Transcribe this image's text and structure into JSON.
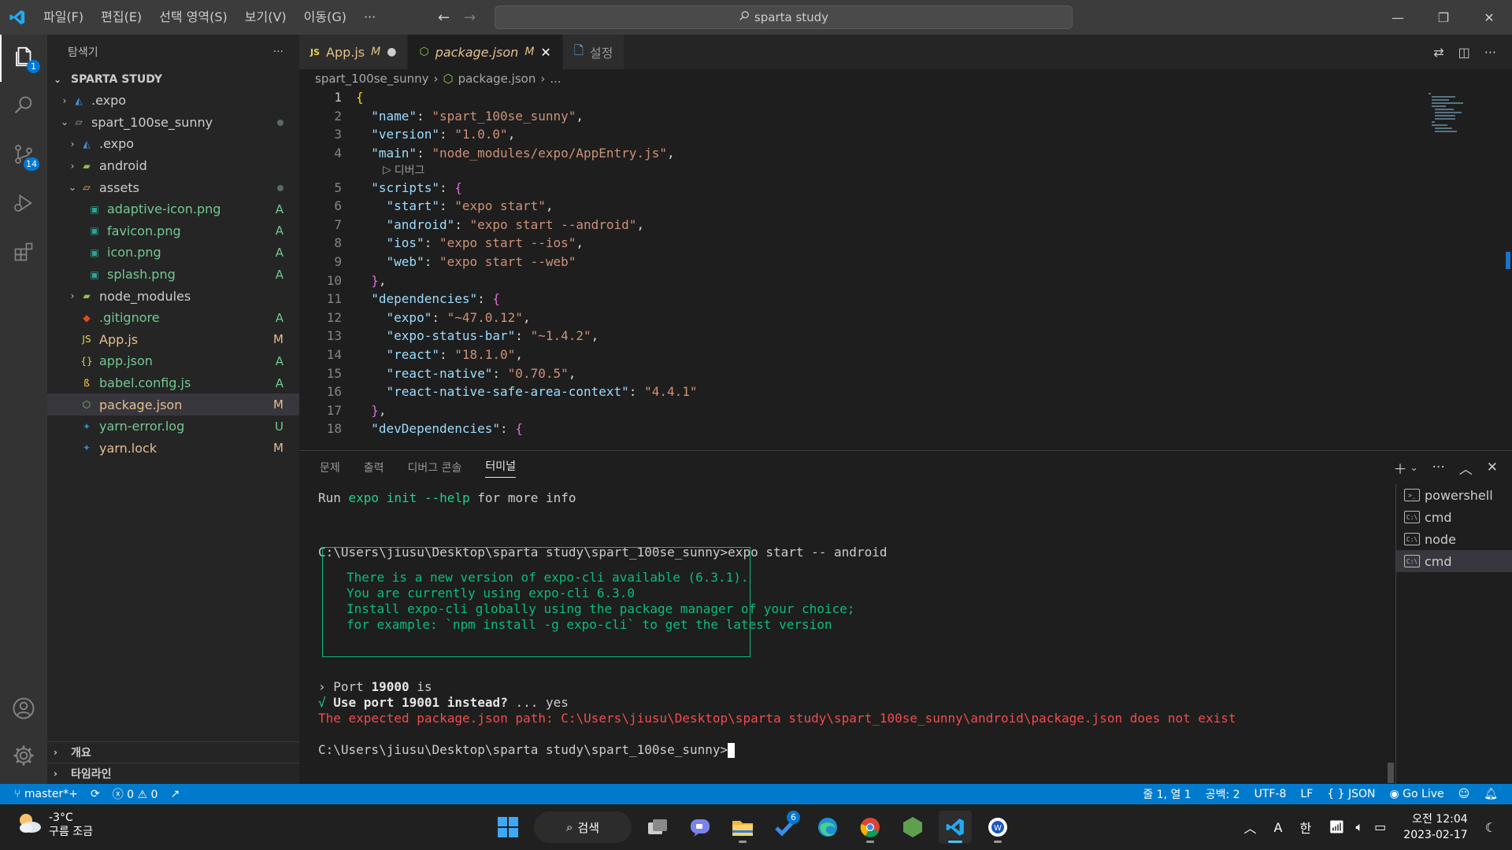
{
  "titlebar": {
    "menu": [
      "파일(F)",
      "편집(E)",
      "선택 영역(S)",
      "보기(V)",
      "이동(G)",
      "···"
    ],
    "search_text": "sparta study"
  },
  "activity": {
    "explorer_badge": "1",
    "scm_badge": "14"
  },
  "sidebar": {
    "header": "탐색기",
    "more": "···",
    "section": "SPARTA STUDY",
    "tree": [
      {
        "name": ".expo",
        "depth": 0,
        "chev": "›",
        "icon": "expo",
        "status": ""
      },
      {
        "name": "spart_100se_sunny",
        "depth": 0,
        "chev": "⌄",
        "icon": "folder-open",
        "status": "dot"
      },
      {
        "name": ".expo",
        "depth": 1,
        "chev": "›",
        "icon": "expo",
        "status": ""
      },
      {
        "name": "android",
        "depth": 1,
        "chev": "›",
        "icon": "folder-android",
        "status": ""
      },
      {
        "name": "assets",
        "depth": 1,
        "chev": "⌄",
        "icon": "folder-open-yellow",
        "status": "dot"
      },
      {
        "name": "adaptive-icon.png",
        "depth": 2,
        "chev": "",
        "icon": "image",
        "status": "A"
      },
      {
        "name": "favicon.png",
        "depth": 2,
        "chev": "",
        "icon": "image",
        "status": "A"
      },
      {
        "name": "icon.png",
        "depth": 2,
        "chev": "",
        "icon": "image",
        "status": "A"
      },
      {
        "name": "splash.png",
        "depth": 2,
        "chev": "",
        "icon": "image",
        "status": "A"
      },
      {
        "name": "node_modules",
        "depth": 1,
        "chev": "›",
        "icon": "folder-node",
        "status": ""
      },
      {
        "name": ".gitignore",
        "depth": 1,
        "chev": "",
        "icon": "git",
        "status": "A"
      },
      {
        "name": "App.js",
        "depth": 1,
        "chev": "",
        "icon": "js",
        "status": "M"
      },
      {
        "name": "app.json",
        "depth": 1,
        "chev": "",
        "icon": "json",
        "status": "A"
      },
      {
        "name": "babel.config.js",
        "depth": 1,
        "chev": "",
        "icon": "babel",
        "status": "A"
      },
      {
        "name": "package.json",
        "depth": 1,
        "chev": "",
        "icon": "node",
        "status": "M"
      },
      {
        "name": "yarn-error.log",
        "depth": 1,
        "chev": "",
        "icon": "yarn",
        "status": "U"
      },
      {
        "name": "yarn.lock",
        "depth": 1,
        "chev": "",
        "icon": "yarn",
        "status": "M"
      }
    ],
    "outline": "개요",
    "timeline": "타임라인"
  },
  "tabs": [
    {
      "label": "App.js",
      "mod": "M",
      "icon": "js",
      "active": false
    },
    {
      "label": "package.json",
      "mod": "M",
      "icon": "node",
      "active": true
    },
    {
      "label": "설정",
      "mod": "",
      "icon": "settings-file",
      "active": false
    }
  ],
  "breadcrumb": [
    "spart_100se_sunny",
    "package.json",
    "..."
  ],
  "code_lens": "디버그",
  "code": [
    {
      "n": "1",
      "t": "{"
    },
    {
      "n": "2",
      "t": "  \"name\": \"spart_100se_sunny\","
    },
    {
      "n": "3",
      "t": "  \"version\": \"1.0.0\","
    },
    {
      "n": "4",
      "t": "  \"main\": \"node_modules/expo/AppEntry.js\","
    },
    {
      "n": "5",
      "t": "  \"scripts\": {"
    },
    {
      "n": "6",
      "t": "    \"start\": \"expo start\","
    },
    {
      "n": "7",
      "t": "    \"android\": \"expo start --android\","
    },
    {
      "n": "8",
      "t": "    \"ios\": \"expo start --ios\","
    },
    {
      "n": "9",
      "t": "    \"web\": \"expo start --web\""
    },
    {
      "n": "10",
      "t": "  },"
    },
    {
      "n": "11",
      "t": "  \"dependencies\": {"
    },
    {
      "n": "12",
      "t": "    \"expo\": \"~47.0.12\","
    },
    {
      "n": "13",
      "t": "    \"expo-status-bar\": \"~1.4.2\","
    },
    {
      "n": "14",
      "t": "    \"react\": \"18.1.0\","
    },
    {
      "n": "15",
      "t": "    \"react-native\": \"0.70.5\","
    },
    {
      "n": "16",
      "t": "    \"react-native-safe-area-context\": \"4.4.1\""
    },
    {
      "n": "17",
      "t": "  },"
    },
    {
      "n": "18",
      "t": "  \"devDependencies\": {"
    }
  ],
  "panel": {
    "tabs": [
      "문제",
      "출력",
      "디버그 콘솔",
      "터미널"
    ],
    "terminal": {
      "line1_pre": "Run ",
      "line1_cmd": "expo init --help",
      "line1_post": " for more info",
      "prompt1": "C:\\Users\\jiusu\\Desktop\\sparta study\\spart_100se_sunny>expo start -- android",
      "box": [
        "There is a new version of expo-cli available (6.3.1).",
        "You are currently using expo-cli 6.3.0",
        "Install expo-cli globally using the package manager of your choice;",
        "for example: `npm install -g expo-cli` to get the latest version"
      ],
      "port_pre": "› Port ",
      "port_num": "19000",
      "port_post": " is",
      "use_check": "√ ",
      "use_text": "Use port 19001 instead?",
      "use_ans": " ... yes",
      "error": "The expected package.json path: C:\\Users\\jiusu\\Desktop\\sparta study\\spart_100se_sunny\\android\\package.json does not exist",
      "prompt2": "C:\\Users\\jiusu\\Desktop\\sparta study\\spart_100se_sunny>"
    },
    "terminals": [
      "powershell",
      "cmd",
      "node",
      "cmd"
    ]
  },
  "statusbar": {
    "branch": "master*+",
    "errors": "0",
    "warnings": "0",
    "position": "줄 1, 열 1",
    "spaces": "공백: 2",
    "encoding": "UTF-8",
    "eol": "LF",
    "language": "JSON",
    "golive": "Go Live"
  },
  "taskbar": {
    "temp": "-3°C",
    "weather": "구름 조금",
    "search": "검색",
    "todo_badge": "6",
    "time": "오전 12:04",
    "date": "2023-02-17",
    "ime": "A",
    "lang": "한"
  }
}
